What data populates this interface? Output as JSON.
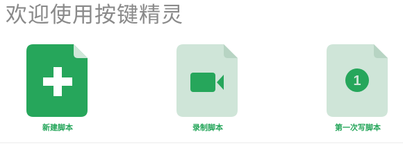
{
  "header": {
    "title": "欢迎使用按键精灵"
  },
  "actions": [
    {
      "label": "新建脚本",
      "icon": "plus-icon"
    },
    {
      "label": "录制脚本",
      "icon": "video-camera-icon"
    },
    {
      "label": "第一次写脚本",
      "icon": "number-one-icon",
      "badge": "1"
    }
  ],
  "colors": {
    "accent": "#26a65b",
    "accent_light": "#cfe5d8",
    "fold_dark": "#b7d4c3",
    "fold_light": "#cfe7d9",
    "title": "#8a8a8a"
  }
}
